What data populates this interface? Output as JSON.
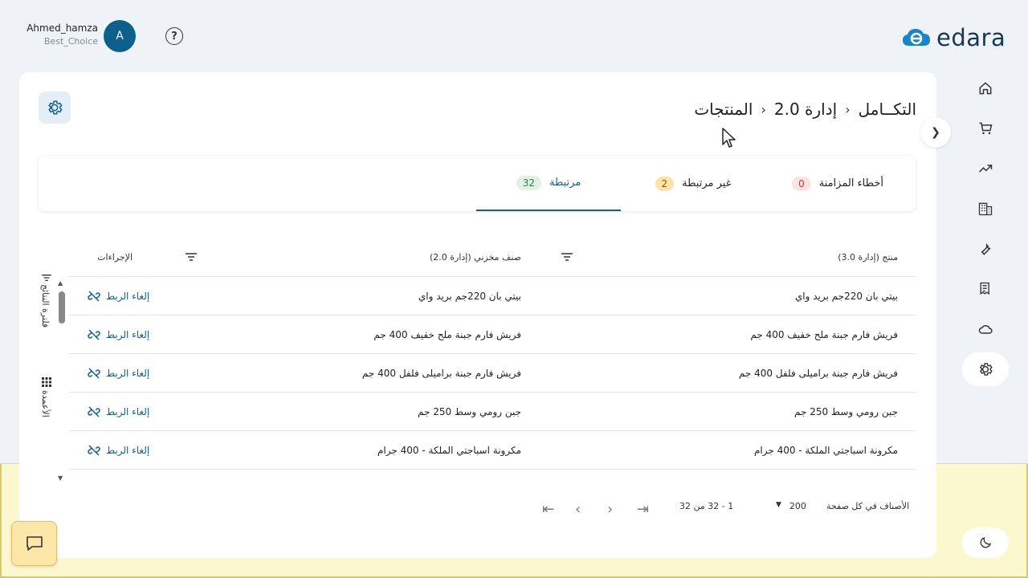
{
  "header": {
    "user_name": "Ahmed_hamza",
    "company": "Best_Choice",
    "avatar_letter": "A",
    "help_label": "?",
    "logo_text": "edara"
  },
  "breadcrumb": {
    "items": [
      "التكــامل",
      "إدارة 2.0",
      "المنتجات"
    ]
  },
  "tabs": [
    {
      "label": "أخطاء المزامنة",
      "count": "0",
      "badge_bg": "#fde3e3",
      "badge_color": "#c0392b"
    },
    {
      "label": "غير مرتبطة",
      "count": "2",
      "badge_bg": "#fde3a8",
      "badge_color": "#7a5a10"
    },
    {
      "label": "مرتبطة",
      "count": "32",
      "badge_bg": "#e2f1e6",
      "badge_color": "#2e7d4f",
      "active": true
    }
  ],
  "table": {
    "columns": [
      "منتج (إدارة 3.0)",
      "صنف مخزني (إدارة 2.0)",
      "الإجراءات"
    ],
    "rows": [
      {
        "product": "بيتي بان 220جم بريد واي",
        "item": "بيتي بان 220جم بريد واي",
        "action": "إلغاء الربط"
      },
      {
        "product": "فريش فارم جبنة ملح خفيف 400 جم",
        "item": "فريش فارم جبنة ملح خفيف 400 جم",
        "action": "إلغاء الربط"
      },
      {
        "product": "فريش فارم جبنة براميلى فلفل 400 جم",
        "item": "فريش فارم جبنة براميلى فلفل 400 جم",
        "action": "إلغاء الربط"
      },
      {
        "product": "جبن رومي وسط 250 جم",
        "item": "جبن رومي وسط 250 جم",
        "action": "إلغاء الربط"
      },
      {
        "product": "مكرونة اسباجتي الملكة - 400 جرام",
        "item": "مكرونة اسباجتي الملكة - 400 جرام",
        "action": "إلغاء الربط"
      }
    ]
  },
  "side_panel": {
    "filter_label": "فلترة النتائج",
    "columns_label": "الأعمدة"
  },
  "pagination": {
    "per_page_label": "الأصناف في كل صفحة",
    "per_page_value": "200",
    "range_text": "1 - 32 من 32"
  },
  "colors": {
    "accent": "#0f5f8c",
    "background": "#eef3f8"
  },
  "nav_icons": [
    "home-icon",
    "cart-icon",
    "trending-icon",
    "building-icon",
    "wrench-icon",
    "receipt-icon",
    "cloud-icon",
    "gear-icon"
  ]
}
